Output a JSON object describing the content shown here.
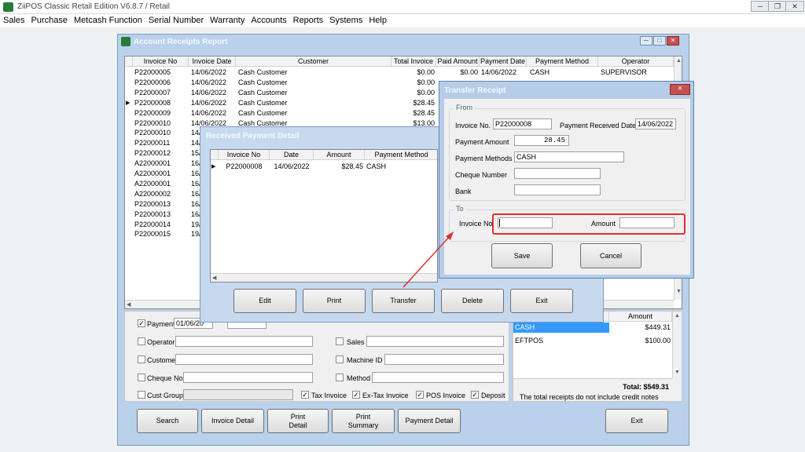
{
  "app": {
    "title": "ZiiPOS Classic Retail Edition V6.8.7 / Retail",
    "menu": [
      "Sales",
      "Purchase",
      "Metcash Function",
      "Serial Number",
      "Warranty",
      "Accounts",
      "Reports",
      "Systems",
      "Help"
    ]
  },
  "receipts_window": {
    "title": "Account Receipts Report",
    "columns": [
      "Invoice No",
      "Invoice Date",
      "Customer",
      "Total Invoice",
      "Paid Amount",
      "Payment Date",
      "Payment Method",
      "Operator"
    ],
    "rows": [
      {
        "inv": "P22000005",
        "date": "14/06/2022",
        "cust": "Cash Customer",
        "total": "$0.00",
        "paid": "$0.00",
        "pdate": "14/06/2022",
        "method": "CASH",
        "op": "SUPERVISOR"
      },
      {
        "inv": "P22000006",
        "date": "14/06/2022",
        "cust": "Cash Customer",
        "total": "$0.00",
        "paid": "",
        "pdate": "",
        "method": "",
        "op": ""
      },
      {
        "inv": "P22000007",
        "date": "14/06/2022",
        "cust": "Cash Customer",
        "total": "$0.00",
        "paid": "",
        "pdate": "",
        "method": "",
        "op": ""
      },
      {
        "inv": "P22000008",
        "date": "14/06/2022",
        "cust": "Cash Customer",
        "total": "$28.45",
        "paid": "",
        "pdate": "",
        "method": "",
        "op": ""
      },
      {
        "inv": "P22000009",
        "date": "14/06/2022",
        "cust": "Cash Customer",
        "total": "$28.45",
        "paid": "",
        "pdate": "",
        "method": "",
        "op": ""
      },
      {
        "inv": "P22000010",
        "date": "14/06/2022",
        "cust": "Cash Customer",
        "total": "$13.00",
        "paid": "",
        "pdate": "",
        "method": "",
        "op": ""
      },
      {
        "inv": "P22000010",
        "date": "14/0",
        "cust": "",
        "total": "",
        "paid": "",
        "pdate": "",
        "method": "",
        "op": ""
      },
      {
        "inv": "P22000011",
        "date": "14/0",
        "cust": "",
        "total": "",
        "paid": "",
        "pdate": "",
        "method": "",
        "op": ""
      },
      {
        "inv": "P22000012",
        "date": "15/0",
        "cust": "",
        "total": "",
        "paid": "",
        "pdate": "",
        "method": "",
        "op": ""
      },
      {
        "inv": "A22000001",
        "date": "16/0",
        "cust": "",
        "total": "",
        "paid": "",
        "pdate": "",
        "method": "",
        "op": ""
      },
      {
        "inv": "A22000001",
        "date": "16/0",
        "cust": "",
        "total": "",
        "paid": "",
        "pdate": "",
        "method": "",
        "op": ""
      },
      {
        "inv": "A22000001",
        "date": "16/0",
        "cust": "",
        "total": "",
        "paid": "",
        "pdate": "",
        "method": "",
        "op": ""
      },
      {
        "inv": "A22000002",
        "date": "16/0",
        "cust": "",
        "total": "",
        "paid": "",
        "pdate": "",
        "method": "",
        "op": ""
      },
      {
        "inv": "P22000013",
        "date": "16/0",
        "cust": "",
        "total": "",
        "paid": "",
        "pdate": "",
        "method": "",
        "op": ""
      },
      {
        "inv": "P22000013",
        "date": "16/0",
        "cust": "",
        "total": "",
        "paid": "",
        "pdate": "",
        "method": "",
        "op": ""
      },
      {
        "inv": "P22000014",
        "date": "19/0",
        "cust": "",
        "total": "",
        "paid": "",
        "pdate": "",
        "method": "",
        "op": ""
      },
      {
        "inv": "P22000015",
        "date": "19/0",
        "cust": "",
        "total": "",
        "paid": "",
        "pdate": "",
        "method": "",
        "op": ""
      }
    ],
    "filters": {
      "payment_label": "Payment",
      "payment_from": "01/06/20",
      "operator_label": "Operator",
      "sales_label": "Sales",
      "customer_label": "Customer",
      "machine_label": "Machine ID",
      "cheque_label": "Cheque No",
      "method_label": "Method",
      "cust_group_label": "Cust Group",
      "tax_invoice": "Tax Invoice",
      "ex_tax_invoice": "Ex-Tax Invoice",
      "pos_invoice": "POS Invoice",
      "deposit": "Deposit"
    },
    "summary": {
      "amount_header": "Amount",
      "rows": [
        {
          "method": "CASH",
          "amount": "$449.31"
        },
        {
          "method": "EFTPOS",
          "amount": "$100.00"
        }
      ],
      "total": "Total: $549.31",
      "note": "The total receipts do not include credit notes"
    },
    "buttons": {
      "search": "Search",
      "invoice_detail": "Invoice Detail",
      "print_detail_1": "Print",
      "print_detail_2": "Detail",
      "print_summary_1": "Print",
      "print_summary_2": "Summary",
      "payment_detail": "Payment Detail",
      "exit": "Exit"
    }
  },
  "payment_window": {
    "title": "Received Payment Detail",
    "columns": [
      "Invoice No",
      "Date",
      "Amount",
      "Payment Method"
    ],
    "row": {
      "inv": "P22000008",
      "date": "14/06/2022",
      "amount": "$28.45",
      "method": "CASH"
    },
    "buttons": {
      "edit": "Edit",
      "print": "Print",
      "transfer": "Transfer",
      "delete": "Delete",
      "exit": "Exit"
    }
  },
  "transfer_window": {
    "title": "Transfer Receipt",
    "from_label": "From",
    "invoice_label": "Invoice No.",
    "invoice_value": "P22000008",
    "received_date_label": "Payment Received Date",
    "received_date_value": "14/06/2022",
    "amount_label": "Payment Amount",
    "amount_value": "28.45",
    "methods_label": "Payment Methods",
    "methods_value": "CASH",
    "cheque_label": "Cheque Number",
    "cheque_value": "",
    "bank_label": "Bank",
    "bank_value": "",
    "to_label": "To",
    "to_invoice_label": "Invoice No",
    "to_invoice_value": "",
    "to_amount_label": "Amount",
    "to_amount_value": "",
    "save": "Save",
    "cancel": "Cancel"
  },
  "colors": {
    "highlight": "#e03030",
    "selection": "#3399ff",
    "title_bar": "#b9d1ea"
  }
}
